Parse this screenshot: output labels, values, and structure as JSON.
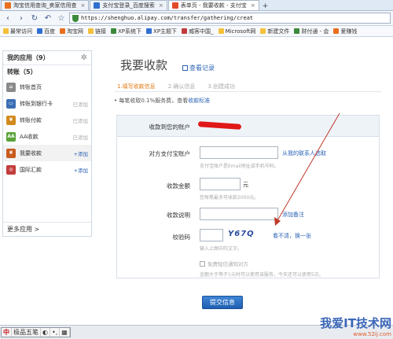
{
  "browser": {
    "tabs": [
      {
        "title": "淘宝信用查询_卖家信用查",
        "color": "#e8701e",
        "active": false
      },
      {
        "title": "支付宝登录_百度搜索",
        "color": "#2f6fd0",
        "active": false
      },
      {
        "title": "表单页 - 我要收款 - 支付宝",
        "color": "#e24a2a",
        "active": true
      }
    ],
    "new_tab": "+",
    "address": "https://shenghuo.alipay.com/transfer/gathering/creat",
    "bookmarks": [
      {
        "label": "最常访问",
        "color": "#f3c13a"
      },
      {
        "label": "百度",
        "color": "#2f6fd0"
      },
      {
        "label": "淘宝网",
        "color": "#e8701e"
      },
      {
        "label": "链接",
        "color": "#f3c13a"
      },
      {
        "label": "XP系统下",
        "color": "#3b8a3b"
      },
      {
        "label": "XP主题下",
        "color": "#2f6fd0"
      },
      {
        "label": "威客中国_",
        "color": "#c23b3b"
      },
      {
        "label": "Microsoft网",
        "color": "#f3c13a"
      },
      {
        "label": "新建文件",
        "color": "#f3c13a"
      },
      {
        "label": "财付通 - 会",
        "color": "#3b8a3b"
      },
      {
        "label": "爱赚钱",
        "color": "#e8701e"
      }
    ]
  },
  "sidebar": {
    "header": "我的应用（9）",
    "section": "转账（5）",
    "items": [
      {
        "label": "转账首页",
        "status": "",
        "color": "#8a8a8a",
        "glyph": "⌂",
        "active": false,
        "add": false
      },
      {
        "label": "转账到银行卡",
        "status": "已添加",
        "color": "#3b6fb5",
        "glyph": "▭",
        "active": false,
        "add": false
      },
      {
        "label": "转账付款",
        "status": "已添加",
        "color": "#d28a1e",
        "glyph": "¥",
        "active": false,
        "add": false
      },
      {
        "label": "AA收款",
        "status": "已添加",
        "color": "#5aa33a",
        "glyph": "AA",
        "active": false,
        "add": false
      },
      {
        "label": "我要收款",
        "status": "+添加",
        "color": "#c85b1e",
        "glyph": "¥",
        "active": true,
        "add": true
      },
      {
        "label": "国际汇款",
        "status": "+添加",
        "color": "#c23b3b",
        "glyph": "◎",
        "active": false,
        "add": true
      }
    ],
    "more": "更多应用 >"
  },
  "main": {
    "title": "我要收款",
    "history_link": "查看记录",
    "steps": [
      "1.填写收款信息",
      "2.确认信息",
      "3.创建成功"
    ],
    "notice_prefix": "• 每笔收取0.1%服务费，查看",
    "notice_link": "收款标准"
  },
  "form": {
    "account_label": "收款到您的账户",
    "payer_label": "对方支付宝账户",
    "payer_link": "从我的联系人选取",
    "payer_hint": "支付宝账户是Email地址或手机号码。",
    "amount_label": "收款金额",
    "amount_unit": "元",
    "amount_hint": "您每笔最多可收款2000元。",
    "note_label": "收款说明",
    "note_link": "添加备注",
    "code_label": "校验码",
    "captcha_text": "Y67Q",
    "captcha_refresh": "看不清，换一张",
    "code_hint": "输入上图中的文字。",
    "sms_label": "免费短信通知对方",
    "sms_hint": "金额大于等于1元时可以使用该服务，今天还可以使用5次。"
  },
  "submit_label": "提交信息",
  "taskbar": {
    "ime": [
      "中",
      "极品五笔",
      "◐",
      "•,",
      "▦"
    ]
  },
  "watermark": {
    "title": "我爱IT技术网",
    "url": "www.52ij.com"
  }
}
